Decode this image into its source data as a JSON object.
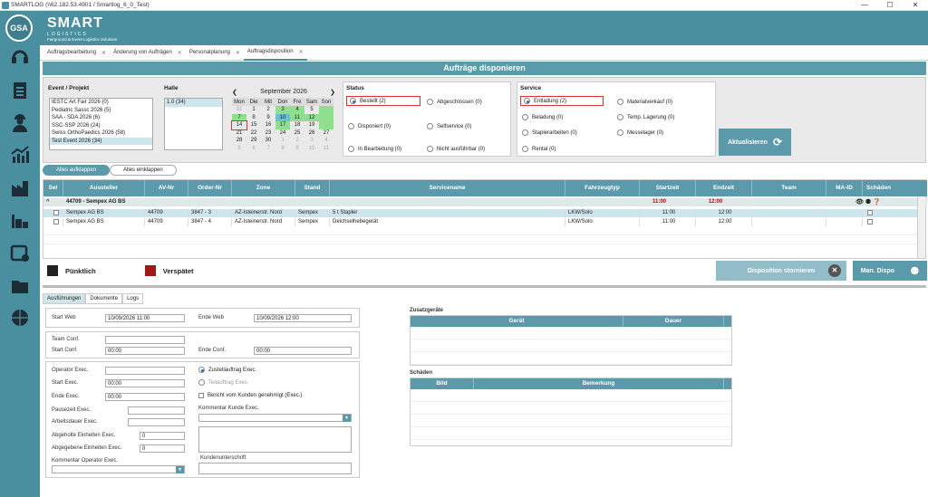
{
  "window": {
    "title": "SMARTLOG (\\\\62.182.53.4901 / Smartlog_6_0_Test)",
    "controls": [
      "—",
      "☐",
      "✕"
    ]
  },
  "sidebar": {
    "user": "GSA",
    "icons": [
      "headset-icon",
      "clipboard-icon",
      "worker-icon",
      "chart-icon",
      "factory-icon",
      "warehouse-icon",
      "calendar-icon",
      "folder-icon",
      "globe-icon"
    ]
  },
  "brand": {
    "name": "SMART",
    "sub": "LOGISTICS",
    "tagline": "Fairground & Event Logistics Solutions"
  },
  "tabs": [
    {
      "label": "Auftragsbearbeitung"
    },
    {
      "label": "Änderung von Aufträgen"
    },
    {
      "label": "Personalplanung"
    },
    {
      "label": "Auftragsdisposition",
      "active": true
    }
  ],
  "page_title": "Aufträge disponieren",
  "filters": {
    "event_label": "Event / Projekt",
    "events": [
      "IESTC Art Fair 2026 (0)",
      "Pediatric Sassc 2026 (5)",
      "SAA - SDA 2026 (6)",
      "SSC-SSP 2026 (24)",
      "Swiss OrthoPaedics 2026 (58)",
      "Test Event 2026 (34)"
    ],
    "halle_label": "Halle",
    "halle": [
      "1.0 (34)"
    ],
    "calendar": {
      "month": "September 2026",
      "days": [
        "Mon",
        "Die",
        "Mit",
        "Don",
        "Fre",
        "Sam",
        "Son"
      ],
      "rows": [
        [
          "31",
          "1",
          "2",
          "3",
          "4",
          "5",
          ""
        ],
        [
          "7",
          "8",
          "9",
          "10",
          "11",
          "12",
          ""
        ],
        [
          "14",
          "15",
          "16",
          "17",
          "18",
          "19",
          ""
        ],
        [
          "21",
          "22",
          "23",
          "24",
          "25",
          "26",
          "27"
        ],
        [
          "28",
          "29",
          "30",
          "1",
          "2",
          "3",
          "4"
        ],
        [
          "5",
          "6",
          "7",
          "8",
          "9",
          "10",
          "11"
        ]
      ]
    },
    "status_label": "Status",
    "status": [
      {
        "label": "Bestellt (2)",
        "on": true
      },
      {
        "label": "Abgeschlossen (0)"
      },
      {
        "label": "Disponiert (0)"
      },
      {
        "label": "Selfservice (0)"
      },
      {
        "label": "In Bearbeitung (0)"
      },
      {
        "label": "Nicht ausführbar (0)"
      }
    ],
    "service_label": "Service",
    "service": [
      {
        "label": "Entladung (2)",
        "on": true
      },
      {
        "label": "Materialverkauf (0)"
      },
      {
        "label": "Beladung (0)"
      },
      {
        "label": "Temp. Lagerung (0)"
      },
      {
        "label": "Staplerarbeiten (0)"
      },
      {
        "label": "Messelager (0)"
      },
      {
        "label": "Rental (0)"
      }
    ],
    "refresh": "Aktualisieren"
  },
  "expand": {
    "open": "Alles aufklappen",
    "close": "Alles einklappen"
  },
  "grid": {
    "columns": [
      "Sel",
      "Aussteller",
      "AV-Nr",
      "Order-Nr",
      "Zone",
      "Stand",
      "Servicename",
      "Fahrzeugtyp",
      "Startzeit",
      "Endzeit",
      "Team",
      "MA-ID",
      "Schäden"
    ],
    "group": {
      "label": "44709 - Sempex AG BS",
      "start": "11:00",
      "end": "12:00"
    },
    "rows": [
      {
        "aussteller": "Sempex AG BS",
        "av": "44709",
        "order": "3847 - 3",
        "zone": "AZ-Isteinerstr. Nord",
        "stand": "Sempex",
        "service": "5 t Stapler",
        "fahrzeug": "LKW/Solo",
        "start": "11:00",
        "end": "12:00"
      },
      {
        "aussteller": "Sempex AG BS",
        "av": "44709",
        "order": "3847 - 4",
        "zone": "AZ-Isteinerstr. Nord",
        "stand": "Sempex",
        "service": "Deichselhebegerät",
        "fahrzeug": "LKW/Solo",
        "start": "11:00",
        "end": "12:00"
      }
    ]
  },
  "legend": {
    "on_time": "Pünktlich",
    "late": "Verspätet",
    "on_time_color": "#222222",
    "late_color": "#a01818"
  },
  "actions": {
    "cancel": "Disposition stornieren",
    "manual": "Man. Dispo"
  },
  "detail_tabs": [
    "Ausführungen",
    "Dokumente",
    "Logs"
  ],
  "detail": {
    "start_web": "Start Web",
    "start_web_val": "10/09/2026 11:00",
    "end_web": "Ende Web",
    "end_web_val": "10/09/2026 12:00",
    "team_conf": "Team Conf.",
    "start_conf": "Start Conf.",
    "start_conf_val": "00:00",
    "end_conf": "Ende Conf.",
    "end_conf_val": "00:00",
    "operator_exec": "Operator Exec.",
    "start_exec": "Start Exec.",
    "start_exec_val": "00:00",
    "end_exec": "Ende Exec.",
    "end_exec_val": "00:00",
    "pause": "Pausezeit Exec.",
    "arbeitsdauer": "Arbeitsdauer Exec.",
    "abgeholt": "Abgeholte Einheiten Exec.",
    "abgeholt_val": "0",
    "abgegeben": "Abgegebene Einheiten Exec.",
    "abgegeben_val": "0",
    "kommentar_op": "Kommentar Operator Exec.",
    "zustell": "Zustellauftrag Exec.",
    "teil": "Teilauftrag Exec.",
    "bericht": "Bericht vom Kunden genehmigt (Exec.)",
    "kommentar_kunde": "Kommentar Kunde Exec.",
    "unterschrift": "Kundenunterschrift"
  },
  "zusatz": {
    "title": "Zusatzgeräte",
    "cols": [
      "Gerät",
      "Dauer"
    ]
  },
  "schaeden": {
    "title": "Schäden",
    "cols": [
      "Bild",
      "Bemerkung"
    ]
  }
}
